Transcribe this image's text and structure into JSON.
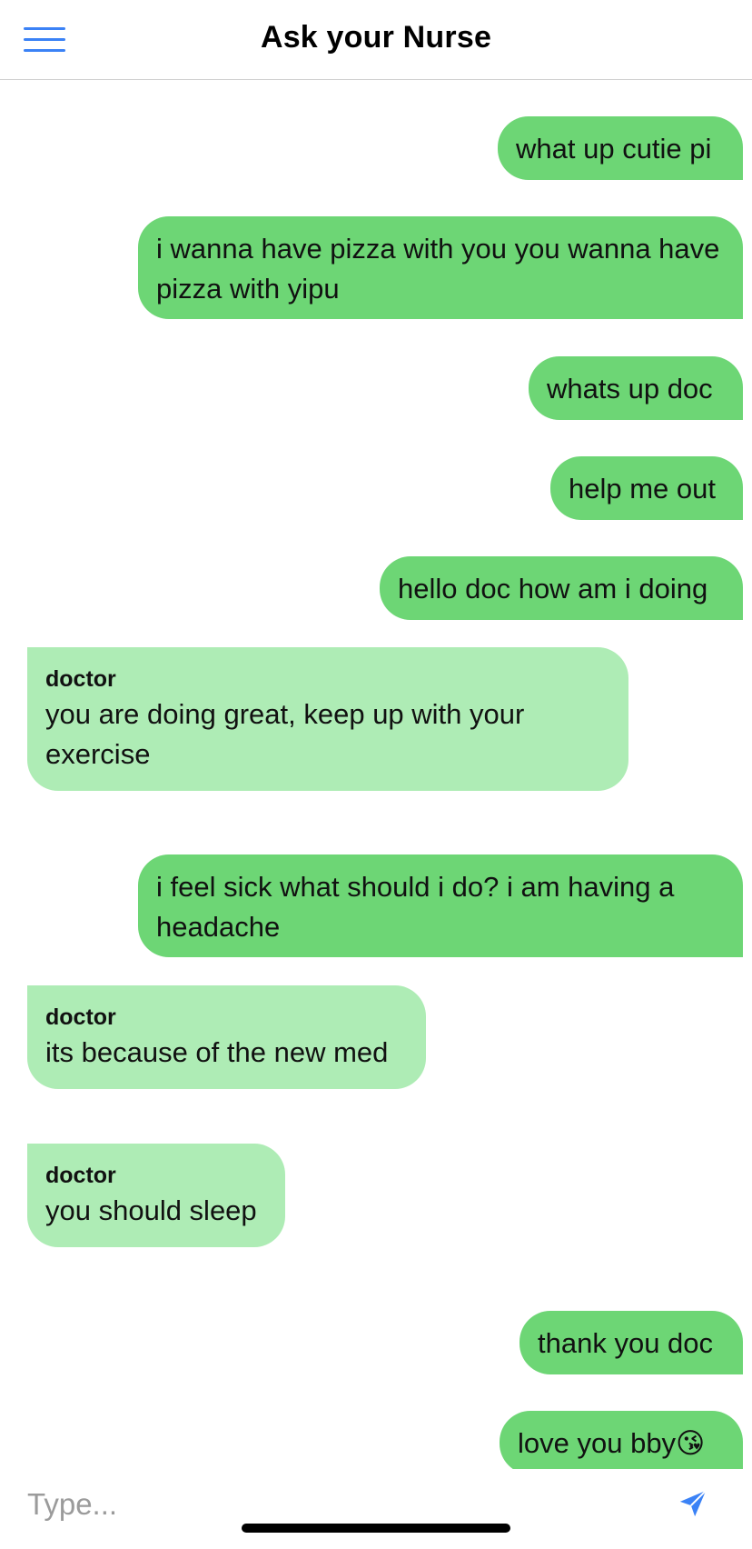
{
  "header": {
    "title": "Ask your Nurse"
  },
  "messages": [
    {
      "from": "me",
      "text": "what up cutie pi"
    },
    {
      "from": "me",
      "text": "i wanna have pizza with you you wanna have pizza with yipu"
    },
    {
      "from": "me",
      "text": "whats up doc"
    },
    {
      "from": "me",
      "text": "help me out"
    },
    {
      "from": "me",
      "text": "hello doc how am i doing"
    },
    {
      "from": "doctor",
      "sender": "doctor",
      "text": "you are doing great, keep up with your exercise"
    },
    {
      "from": "me",
      "text": "i feel sick what should i do? i am having a headache"
    },
    {
      "from": "doctor",
      "sender": "doctor",
      "text": "its because of the new med"
    },
    {
      "from": "doctor",
      "sender": "doctor",
      "text": "you should sleep"
    },
    {
      "from": "me",
      "text": "thank you doc"
    },
    {
      "from": "me",
      "text": "love you bby😘"
    }
  ],
  "composer": {
    "placeholder": "Type...",
    "send_icon": "send-icon"
  },
  "colors": {
    "accent": "#3b82f6",
    "outgoing_bubble": "#6dd675",
    "incoming_bubble": "#aeecb5"
  }
}
